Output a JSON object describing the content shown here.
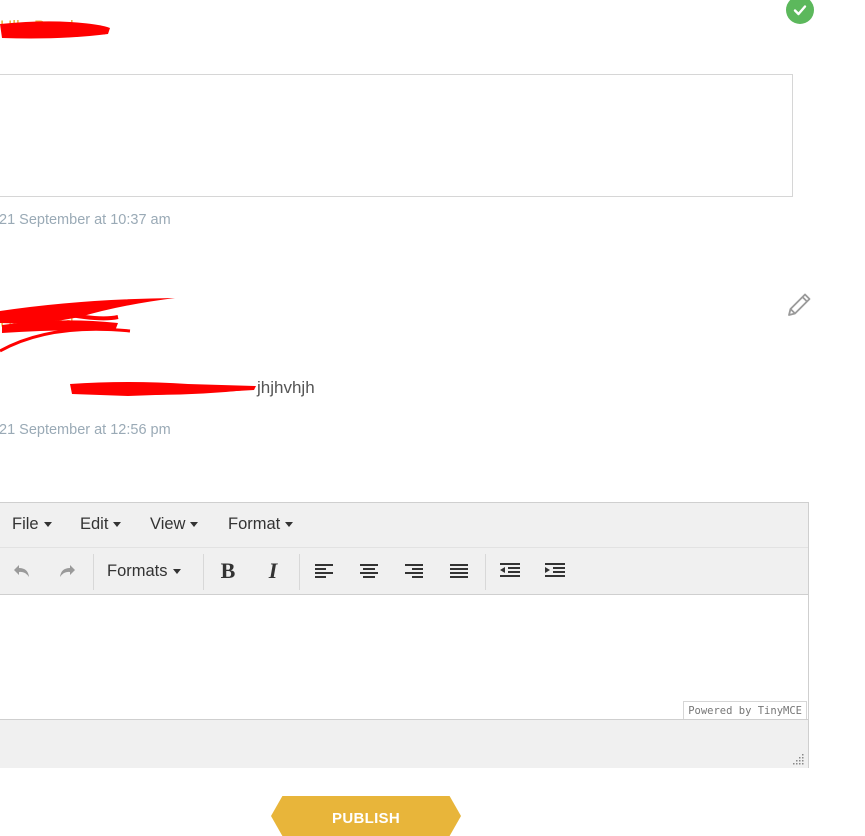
{
  "comments": [
    {
      "author": "",
      "timestamp": "21 September at 10:37 am",
      "status_icon": "check-circle-icon",
      "status_color": "#5cb85c"
    },
    {
      "author": "",
      "text": "jhjhvhjh",
      "timestamp": "21 September at 12:56 pm",
      "action_icon": "pencil-icon"
    }
  ],
  "editor": {
    "menubar": {
      "file": "File",
      "edit": "Edit",
      "view": "View",
      "format": "Format"
    },
    "toolbar": {
      "undo_icon": "undo-icon",
      "redo_icon": "redo-icon",
      "formats": "Formats",
      "bold": "B",
      "italic": "I",
      "align_icons": [
        "align-left-icon",
        "align-center-icon",
        "align-right-icon",
        "align-justify-icon"
      ],
      "indent_icons": [
        "outdent-icon",
        "indent-icon"
      ]
    },
    "powered_by": "Powered by TinyMCE"
  },
  "publish_label": "PUBLISH",
  "colors": {
    "accent": "#e8b53a",
    "timestamp": "#9aaab6",
    "redaction": "#ff0000"
  }
}
